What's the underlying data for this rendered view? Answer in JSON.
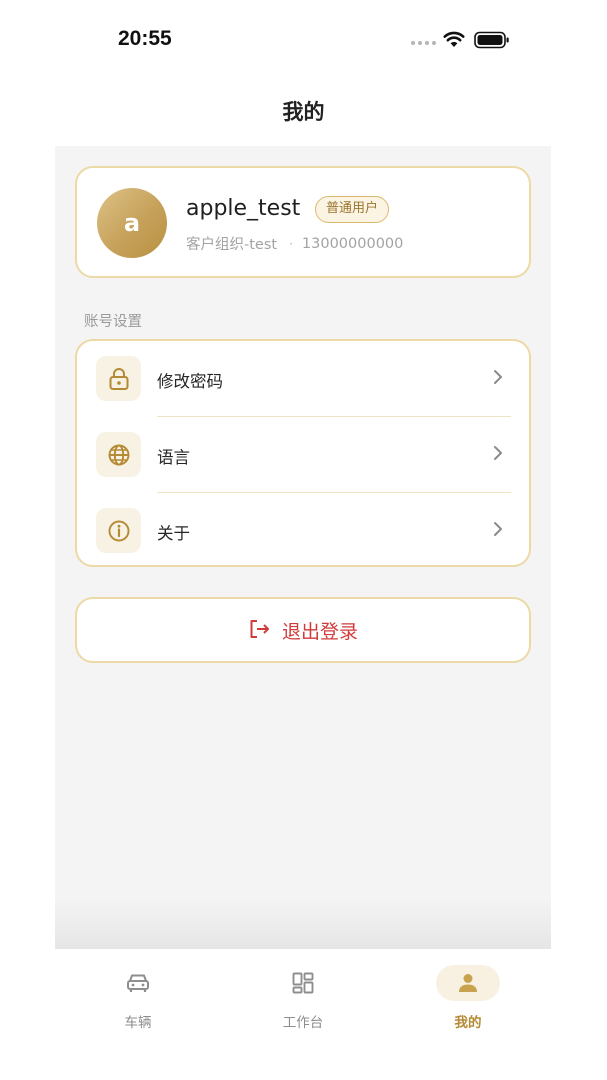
{
  "status_bar": {
    "time": "20:55"
  },
  "header": {
    "title": "我的"
  },
  "profile": {
    "avatar_letter": "a",
    "username": "apple_test",
    "role": "普通用户",
    "organization": "客户组织-test",
    "separator": "·",
    "phone": "13000000000"
  },
  "account_settings": {
    "section_label": "账号设置",
    "items": [
      {
        "label": "修改密码",
        "icon": "lock-icon"
      },
      {
        "label": "语言",
        "icon": "globe-icon"
      },
      {
        "label": "关于",
        "icon": "info-icon"
      }
    ]
  },
  "logout": {
    "label": "退出登录",
    "icon": "logout-icon"
  },
  "tab_bar": {
    "active": "mine",
    "tabs": [
      {
        "id": "vehicle",
        "label": "车辆",
        "icon": "car-icon"
      },
      {
        "id": "workbench",
        "label": "工作台",
        "icon": "dashboard-grid-icon"
      },
      {
        "id": "mine",
        "label": "我的",
        "icon": "person-icon"
      }
    ]
  },
  "colors": {
    "accent_gold": "#b58a35",
    "card_border": "#ecd9a6",
    "logout_red": "#d13b3b",
    "background_gray": "#f4f4f4"
  }
}
